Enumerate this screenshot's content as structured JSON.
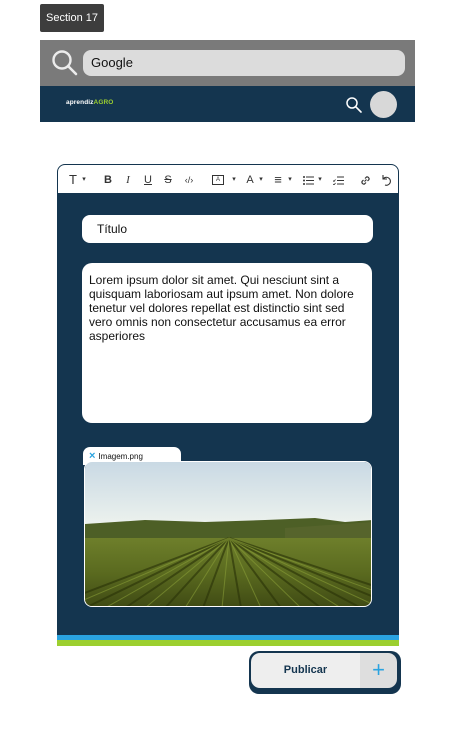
{
  "section_label": "Section 17",
  "browser": {
    "url_value": "Google",
    "search_icon": "search-icon"
  },
  "header": {
    "logo_prefix": "aprendiz",
    "logo_suffix": "AGRO",
    "search_icon": "search-icon",
    "avatar": "avatar"
  },
  "toolbar": {
    "items": [
      {
        "name": "text-style-icon",
        "glyph": "T"
      },
      {
        "name": "bold-icon",
        "glyph": "B"
      },
      {
        "name": "italic-icon",
        "glyph": "I"
      },
      {
        "name": "underline-icon",
        "glyph": "U"
      },
      {
        "name": "strikethrough-icon",
        "glyph": "S"
      },
      {
        "name": "code-icon",
        "glyph": "‹/›"
      },
      {
        "name": "text-box-icon",
        "glyph": "A"
      },
      {
        "name": "font-color-icon",
        "glyph": "A"
      },
      {
        "name": "align-icon",
        "glyph": "≡"
      },
      {
        "name": "bullet-list-icon",
        "glyph": "☰"
      },
      {
        "name": "checklist-icon",
        "glyph": "☑"
      },
      {
        "name": "link-icon",
        "glyph": "🔗"
      },
      {
        "name": "undo-icon",
        "glyph": "↶"
      }
    ]
  },
  "form": {
    "title_value": "Título",
    "body_text": "Lorem ipsum dolor sit amet. Qui nesciunt sint a quisquam laboriosam aut ipsum amet. Non dolore tenetur vel dolores repellat est distinctio sint sed vero omnis non consectetur accusamus ea error asperiores",
    "attachment_name": "Imagem.png",
    "attachment_remove": "×"
  },
  "actions": {
    "publish_label": "Publicar",
    "add_label": "+"
  },
  "colors": {
    "primary": "#14354f",
    "accent_blue": "#2aa3e0",
    "accent_green": "#9ccf2f"
  }
}
